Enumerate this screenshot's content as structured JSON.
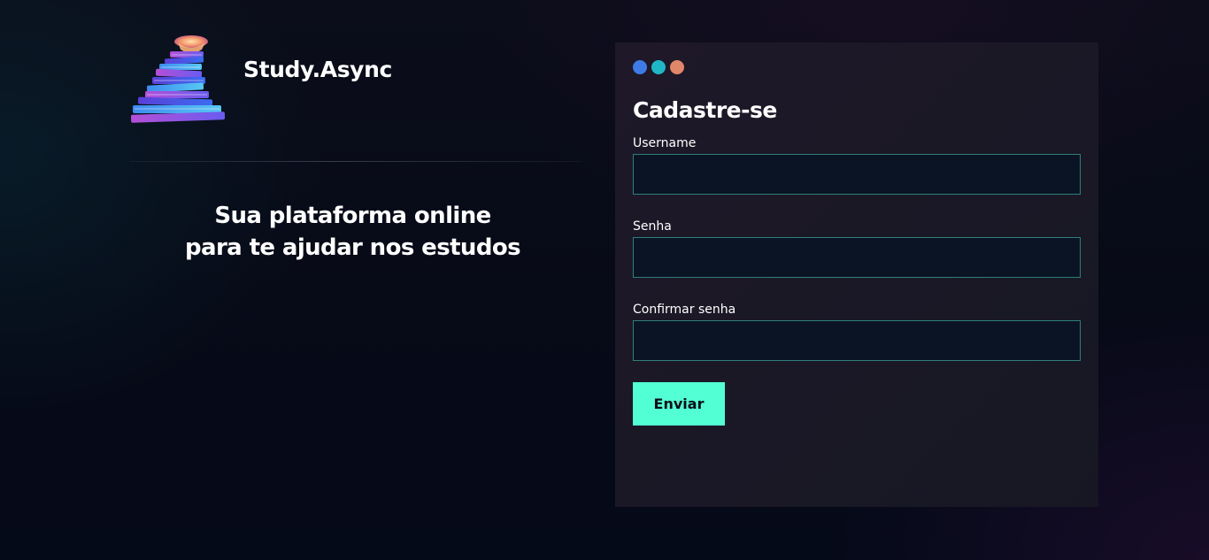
{
  "brand": {
    "name": "Study.Async",
    "logo_icon": "book-stack-logo-icon"
  },
  "tagline": {
    "line1": "Sua plataforma online",
    "line2": "para te ajudar nos estudos"
  },
  "form": {
    "window_dots": [
      {
        "icon": "dot-blue-icon",
        "color": "#3f7be6"
      },
      {
        "icon": "dot-teal-icon",
        "color": "#1fb7c7"
      },
      {
        "icon": "dot-orange-icon",
        "color": "#e0876a"
      }
    ],
    "title": "Cadastre-se",
    "fields": [
      {
        "label": "Username",
        "value": "",
        "placeholder": ""
      },
      {
        "label": "Senha",
        "value": "",
        "placeholder": ""
      },
      {
        "label": "Confirmar senha",
        "value": "",
        "placeholder": ""
      }
    ],
    "submit_label": "Enviar"
  },
  "colors": {
    "accent": "#52ffd4",
    "input_border": "#2f7f7a",
    "input_background": "#0a1424",
    "card_background": "#1b1826"
  }
}
